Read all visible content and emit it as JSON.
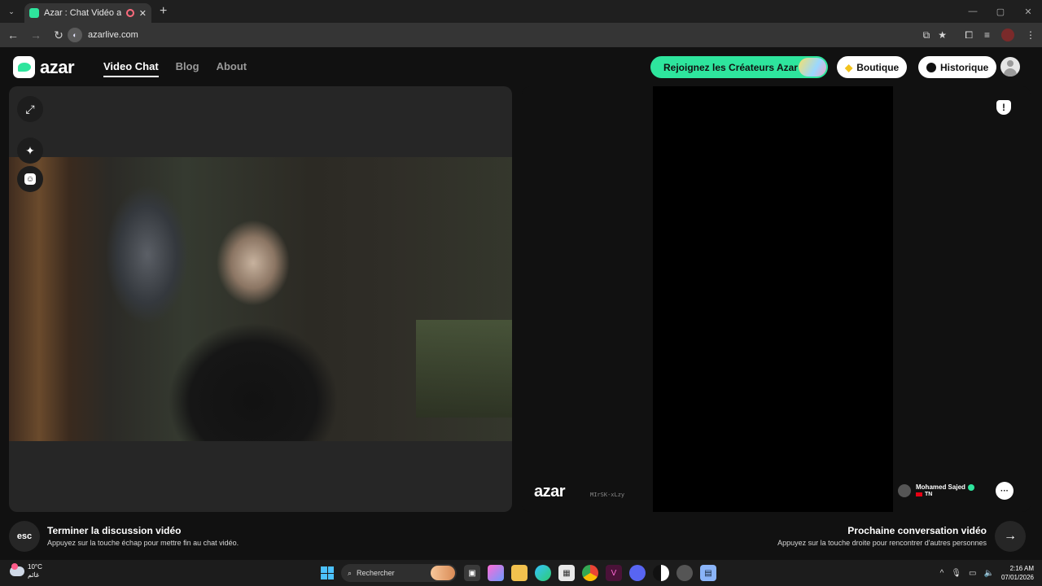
{
  "browser": {
    "tab_title": "Azar : Chat Vidéo avec de n",
    "tab_close": "✕",
    "new_tab": "+",
    "url": "azarlive.com",
    "site_icon_glyph": "◐",
    "window_controls": [
      "—",
      "▢",
      "✕"
    ]
  },
  "header": {
    "logo_text": "azar",
    "nav": [
      "Video Chat",
      "Blog",
      "About"
    ],
    "active_nav": "Video Chat",
    "creators_label": "Rejoignez les Créateurs Azar",
    "shop_label": "Boutique",
    "history_label": "Historique"
  },
  "left_panel": {
    "tools": [
      "expand-icon",
      "sparkle-effects-icon",
      "face-filter-icon"
    ]
  },
  "right_panel": {
    "watermark_logo": "azar",
    "watermark_code": "MIrSK-xLzy",
    "partner_name": "Mohamed Sajed",
    "partner_country": "TN",
    "report_glyph": "!",
    "chat_glyph": "···"
  },
  "footer": {
    "esc_label": "esc",
    "end_title": "Terminer la discussion vidéo",
    "end_subtitle": "Appuyez sur la touche échap pour mettre fin au chat vidéo.",
    "next_title": "Prochaine conversation vidéo",
    "next_subtitle": "Appuyez sur la touche droite pour rencontrer d'autres personnes",
    "next_arrow": "→"
  },
  "taskbar": {
    "temperature": "10°C",
    "weather_label": "غائم",
    "search_label": "Rechercher",
    "time": "2:16 AM",
    "date": "07/01/2026"
  },
  "colors": {
    "accent_green": "#2ee59d",
    "panel_bg": "#262626",
    "page_bg": "#111111"
  }
}
